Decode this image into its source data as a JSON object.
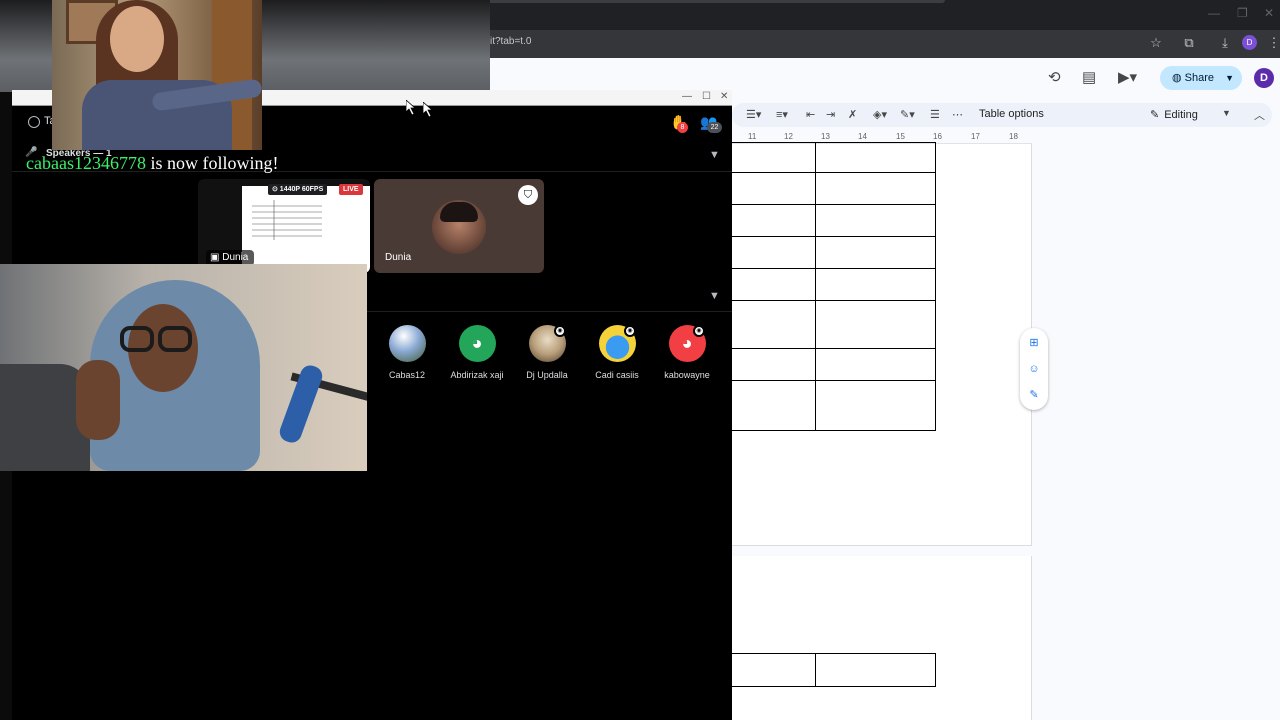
{
  "browser": {
    "url_fragment": "it?tab=t.0",
    "profile_initial": "D"
  },
  "docs": {
    "share_label": "Share",
    "avatar_initial": "D",
    "table_options_label": "Table options",
    "editing_label": "Editing",
    "ruler": [
      "11",
      "12",
      "13",
      "14",
      "15",
      "16",
      "17",
      "18"
    ]
  },
  "discord": {
    "channel_name": "Ta",
    "hand_badge": "8",
    "people_badge": "22",
    "speakers_label": "Speakers — 1",
    "stream_quality": "⊙ 1440P 60FPS",
    "live_label": "LIVE",
    "stream_user": "Dunia",
    "tile_user": "Dunia",
    "audience": [
      {
        "name": "Cabas12",
        "color": "#8aa9d4"
      },
      {
        "name": "Abdirizak xaji",
        "color": "#23a55a"
      },
      {
        "name": "Dj Updalla",
        "color": "#d8c9b0"
      },
      {
        "name": "Cadi casiis",
        "color": "#f5d23a"
      },
      {
        "name": "kabowayne",
        "color": "#f23f43"
      }
    ]
  },
  "overlay": {
    "follower_name": "cabaas12346778",
    "follow_message": " is now following!"
  }
}
